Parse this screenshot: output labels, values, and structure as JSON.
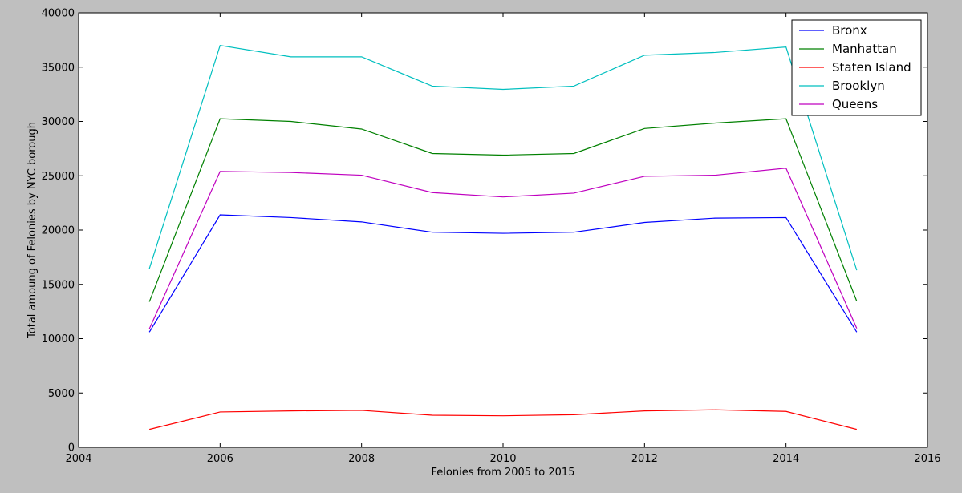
{
  "chart_data": {
    "type": "line",
    "title": "",
    "xlabel": "Felonies from 2005 to 2015",
    "ylabel": "Total amoung of Felonies by NYC borough",
    "xlim": [
      2004,
      2016
    ],
    "ylim": [
      0,
      40000
    ],
    "xticks": [
      "2004",
      "2006",
      "2008",
      "2010",
      "2012",
      "2014",
      "2016"
    ],
    "yticks": [
      "0",
      "5000",
      "10000",
      "15000",
      "20000",
      "25000",
      "30000",
      "35000",
      "40000"
    ],
    "x": [
      2005,
      2006,
      2007,
      2008,
      2009,
      2010,
      2011,
      2012,
      2013,
      2014,
      2015
    ],
    "grid": false,
    "legend_position": "top-right",
    "series": [
      {
        "name": "Bronx",
        "color": "#0000ff",
        "values": [
          10600,
          21400,
          21150,
          20750,
          19800,
          19700,
          19800,
          20700,
          21100,
          21150,
          10600
        ]
      },
      {
        "name": "Manhattan",
        "color": "#008000",
        "values": [
          13400,
          30250,
          30000,
          29300,
          27050,
          26900,
          27050,
          29350,
          29850,
          30250,
          13450
        ]
      },
      {
        "name": "Staten Island",
        "color": "#ff0000",
        "values": [
          1650,
          3250,
          3350,
          3400,
          2950,
          2900,
          3000,
          3350,
          3450,
          3300,
          1650
        ]
      },
      {
        "name": "Brooklyn",
        "color": "#00bfbf",
        "values": [
          16450,
          37000,
          35950,
          35950,
          33250,
          32950,
          33250,
          36100,
          36350,
          36850,
          16300
        ]
      },
      {
        "name": "Queens",
        "color": "#bf00bf",
        "values": [
          10900,
          25400,
          25300,
          25050,
          23450,
          23050,
          23400,
          24950,
          25050,
          25700,
          10950
        ]
      }
    ]
  }
}
